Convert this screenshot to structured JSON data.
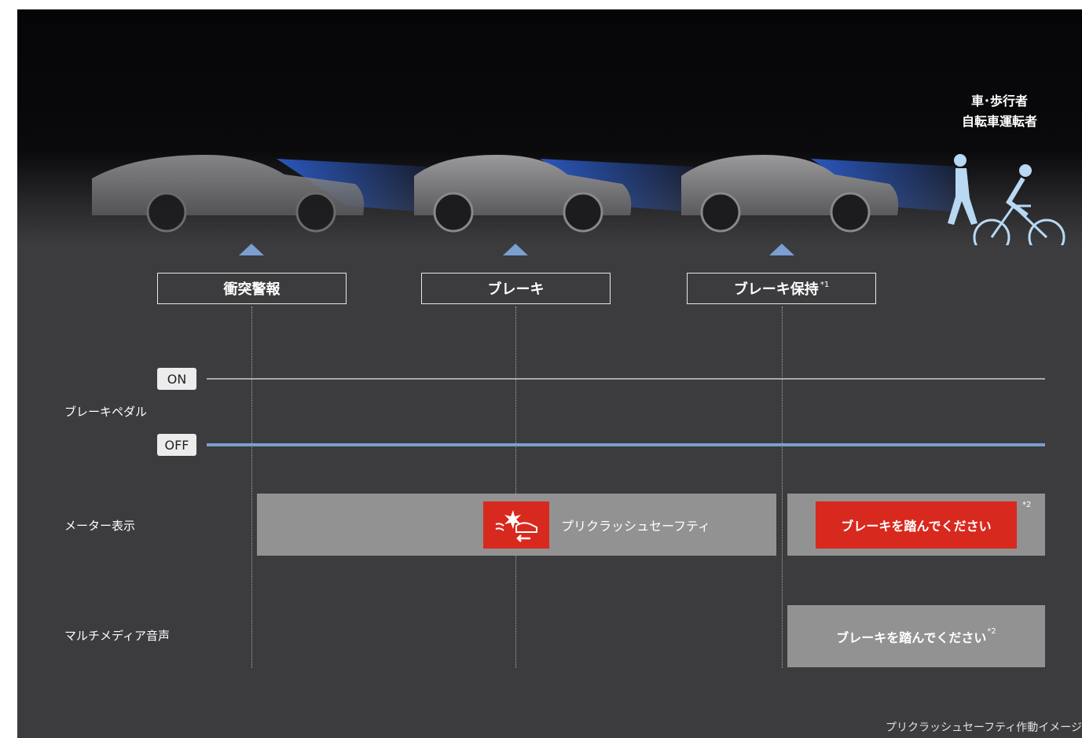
{
  "targets": {
    "line1": "車･歩行者",
    "line2": "自転車運転者"
  },
  "stages": [
    {
      "label": "衝突警報",
      "note": ""
    },
    {
      "label": "ブレーキ",
      "note": ""
    },
    {
      "label": "ブレーキ保持",
      "note": "*1"
    }
  ],
  "pedal": {
    "label": "ブレーキペダル",
    "on": "ON",
    "off": "OFF"
  },
  "meter": {
    "label": "メーター表示",
    "display": "プリクラッシュセーフティ",
    "warning": "ブレーキを踏んでください",
    "note": "*2",
    "icon": "pre-crash-safety-icon"
  },
  "voice": {
    "label": "マルチメディア音声",
    "message": "ブレーキを踏んでください",
    "note": "*2"
  },
  "caption": "プリクラッシュセーフティ作動イメージ",
  "colors": {
    "accent": "#7b9fd0",
    "alert": "#d8291f",
    "panel": "#3c3c3e"
  }
}
